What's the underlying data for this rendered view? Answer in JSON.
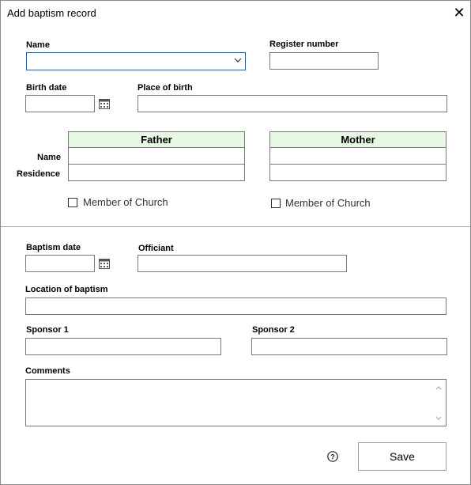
{
  "window": {
    "title": "Add baptism record",
    "close_icon": "close-icon"
  },
  "fields": {
    "name_label": "Name",
    "name_value": "",
    "register_label": "Register number",
    "register_value": "",
    "birth_date_label": "Birth date",
    "birth_date_value": "",
    "place_of_birth_label": "Place of birth",
    "place_of_birth_value": "",
    "baptism_date_label": "Baptism date",
    "baptism_date_value": "",
    "officiant_label": "Officiant",
    "officiant_value": "",
    "location_label": "Location of baptism",
    "location_value": "",
    "sponsor1_label": "Sponsor 1",
    "sponsor1_value": "",
    "sponsor2_label": "Sponsor 2",
    "sponsor2_value": "",
    "comments_label": "Comments",
    "comments_value": ""
  },
  "parents": {
    "row_labels": [
      "Name",
      "Residence"
    ],
    "father": {
      "header": "Father",
      "name": "",
      "residence": "",
      "member_label": "Member of Church",
      "member_checked": false
    },
    "mother": {
      "header": "Mother",
      "name": "",
      "residence": "",
      "member_label": "Member of Church",
      "member_checked": false
    },
    "header_bg": "#e6f8e3"
  },
  "actions": {
    "save_label": "Save",
    "help_icon": "help-icon"
  },
  "colors": {
    "focus_border": "#0a64d2"
  }
}
